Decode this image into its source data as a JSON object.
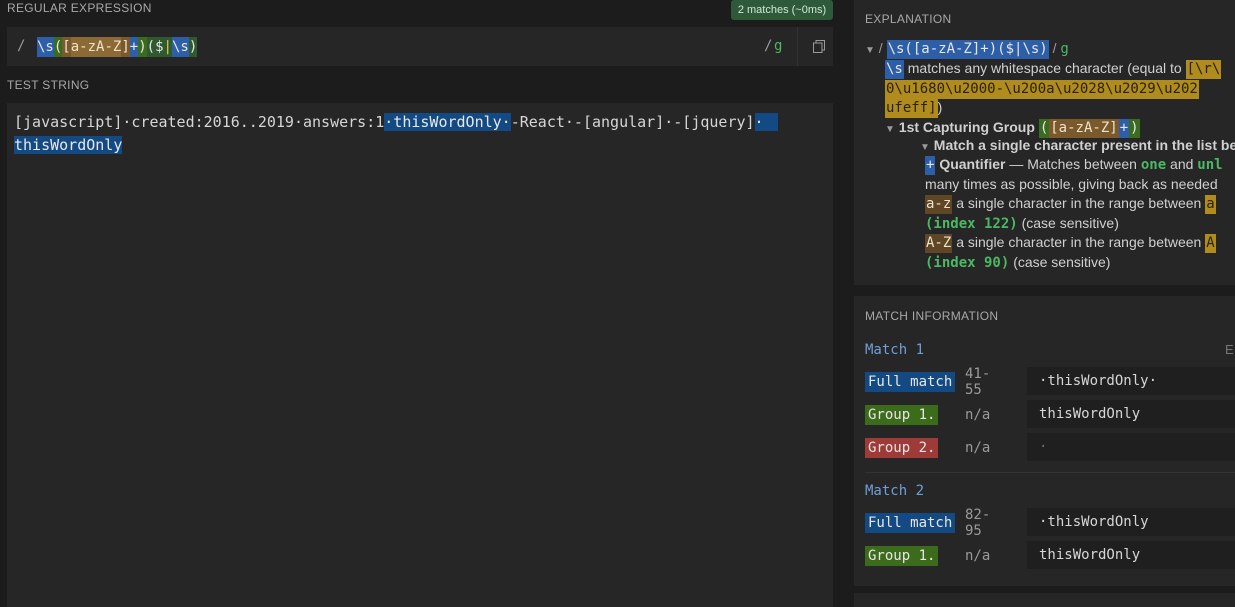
{
  "regex": {
    "section_label": "REGULAR EXPRESSION",
    "badge": "2 matches (~0ms)",
    "open_delim": "/",
    "tokens": {
      "ws1": "\\s",
      "paren_open": "(",
      "set_open": "[",
      "range1": "a-z",
      "range2": "A-Z",
      "set_close": "]",
      "plus": "+",
      "paren_close": ")",
      "g2_open": "(",
      "dollar": "$",
      "pipe": "|",
      "ws2": "\\s",
      "g2_close": ")"
    },
    "close_delim": "/",
    "flags": "g",
    "copy_icon": "copy-icon"
  },
  "test_string": {
    "section_label": "TEST STRING",
    "line1": {
      "pre": "[javascript]·created:2016..2019·answers:1",
      "match1": "·thisWordOnly·",
      "post": "-React·-[angular]·-[jquery]",
      "match2_start": "·"
    },
    "line2": {
      "match2_end": "thisWordOnly"
    }
  },
  "explanation": {
    "section_label": "EXPLANATION",
    "header_regex": "\\s([a-zA-Z]+)($|\\s)",
    "header_delim_open": "/",
    "header_delim_close": "/",
    "header_flag": "g",
    "ws_token": "\\s",
    "ws_desc": "matches any whitespace character (equal to",
    "ws_list1": "[\\r\\",
    "ws_list2": "0\\u1680\\u2000-\\u200a\\u2028\\u2029\\u202",
    "ws_list3": "ufeff]",
    "ws_list3_close": ")",
    "group1_title": "1st Capturing Group",
    "group1_open": "(",
    "group1_set": "[a-zA-Z]",
    "group1_plus": "+",
    "group1_close": ")",
    "match_single": "Match a single character present in the list be",
    "quant_token": "+",
    "quant_title": "Quantifier",
    "quant_desc1": "— Matches between",
    "quant_one": "one",
    "quant_and": "and",
    "quant_unl": "unl",
    "quant_desc2": "many times as possible, giving back as needed",
    "range1_token": "a-z",
    "range1_desc": "a single character in the range between",
    "range1_a": "a",
    "range1_index": "(index 122)",
    "range1_case": "(case sensitive)",
    "range2_token": "A-Z",
    "range2_desc": "a single character in the range between",
    "range2_a": "A",
    "range2_index": "(index 90)",
    "range2_case": "(case sensitive)"
  },
  "match_info": {
    "section_label": "MATCH INFORMATION",
    "export_letter": "E",
    "matches": [
      {
        "title": "Match 1",
        "rows": [
          {
            "tag": "Full match",
            "range": "41-55",
            "value": "·thisWordOnly·"
          },
          {
            "tag": "Group 1.",
            "range": "n/a",
            "value": "thisWordOnly"
          },
          {
            "tag": "Group 2.",
            "range": "n/a",
            "value": "·"
          }
        ]
      },
      {
        "title": "Match 2",
        "rows": [
          {
            "tag": "Full match",
            "range": "82-95",
            "value": "·thisWordOnly"
          },
          {
            "tag": "Group 1.",
            "range": "n/a",
            "value": "thisWordOnly"
          }
        ]
      }
    ]
  },
  "colors": {
    "background": "#1c1c1c",
    "panel": "#262626",
    "match_highlight": "#134a84",
    "group1": "#3d6b1c",
    "group2": "#9e3a38",
    "badge": "#2f5a3a",
    "flag_green": "#4bb864"
  }
}
